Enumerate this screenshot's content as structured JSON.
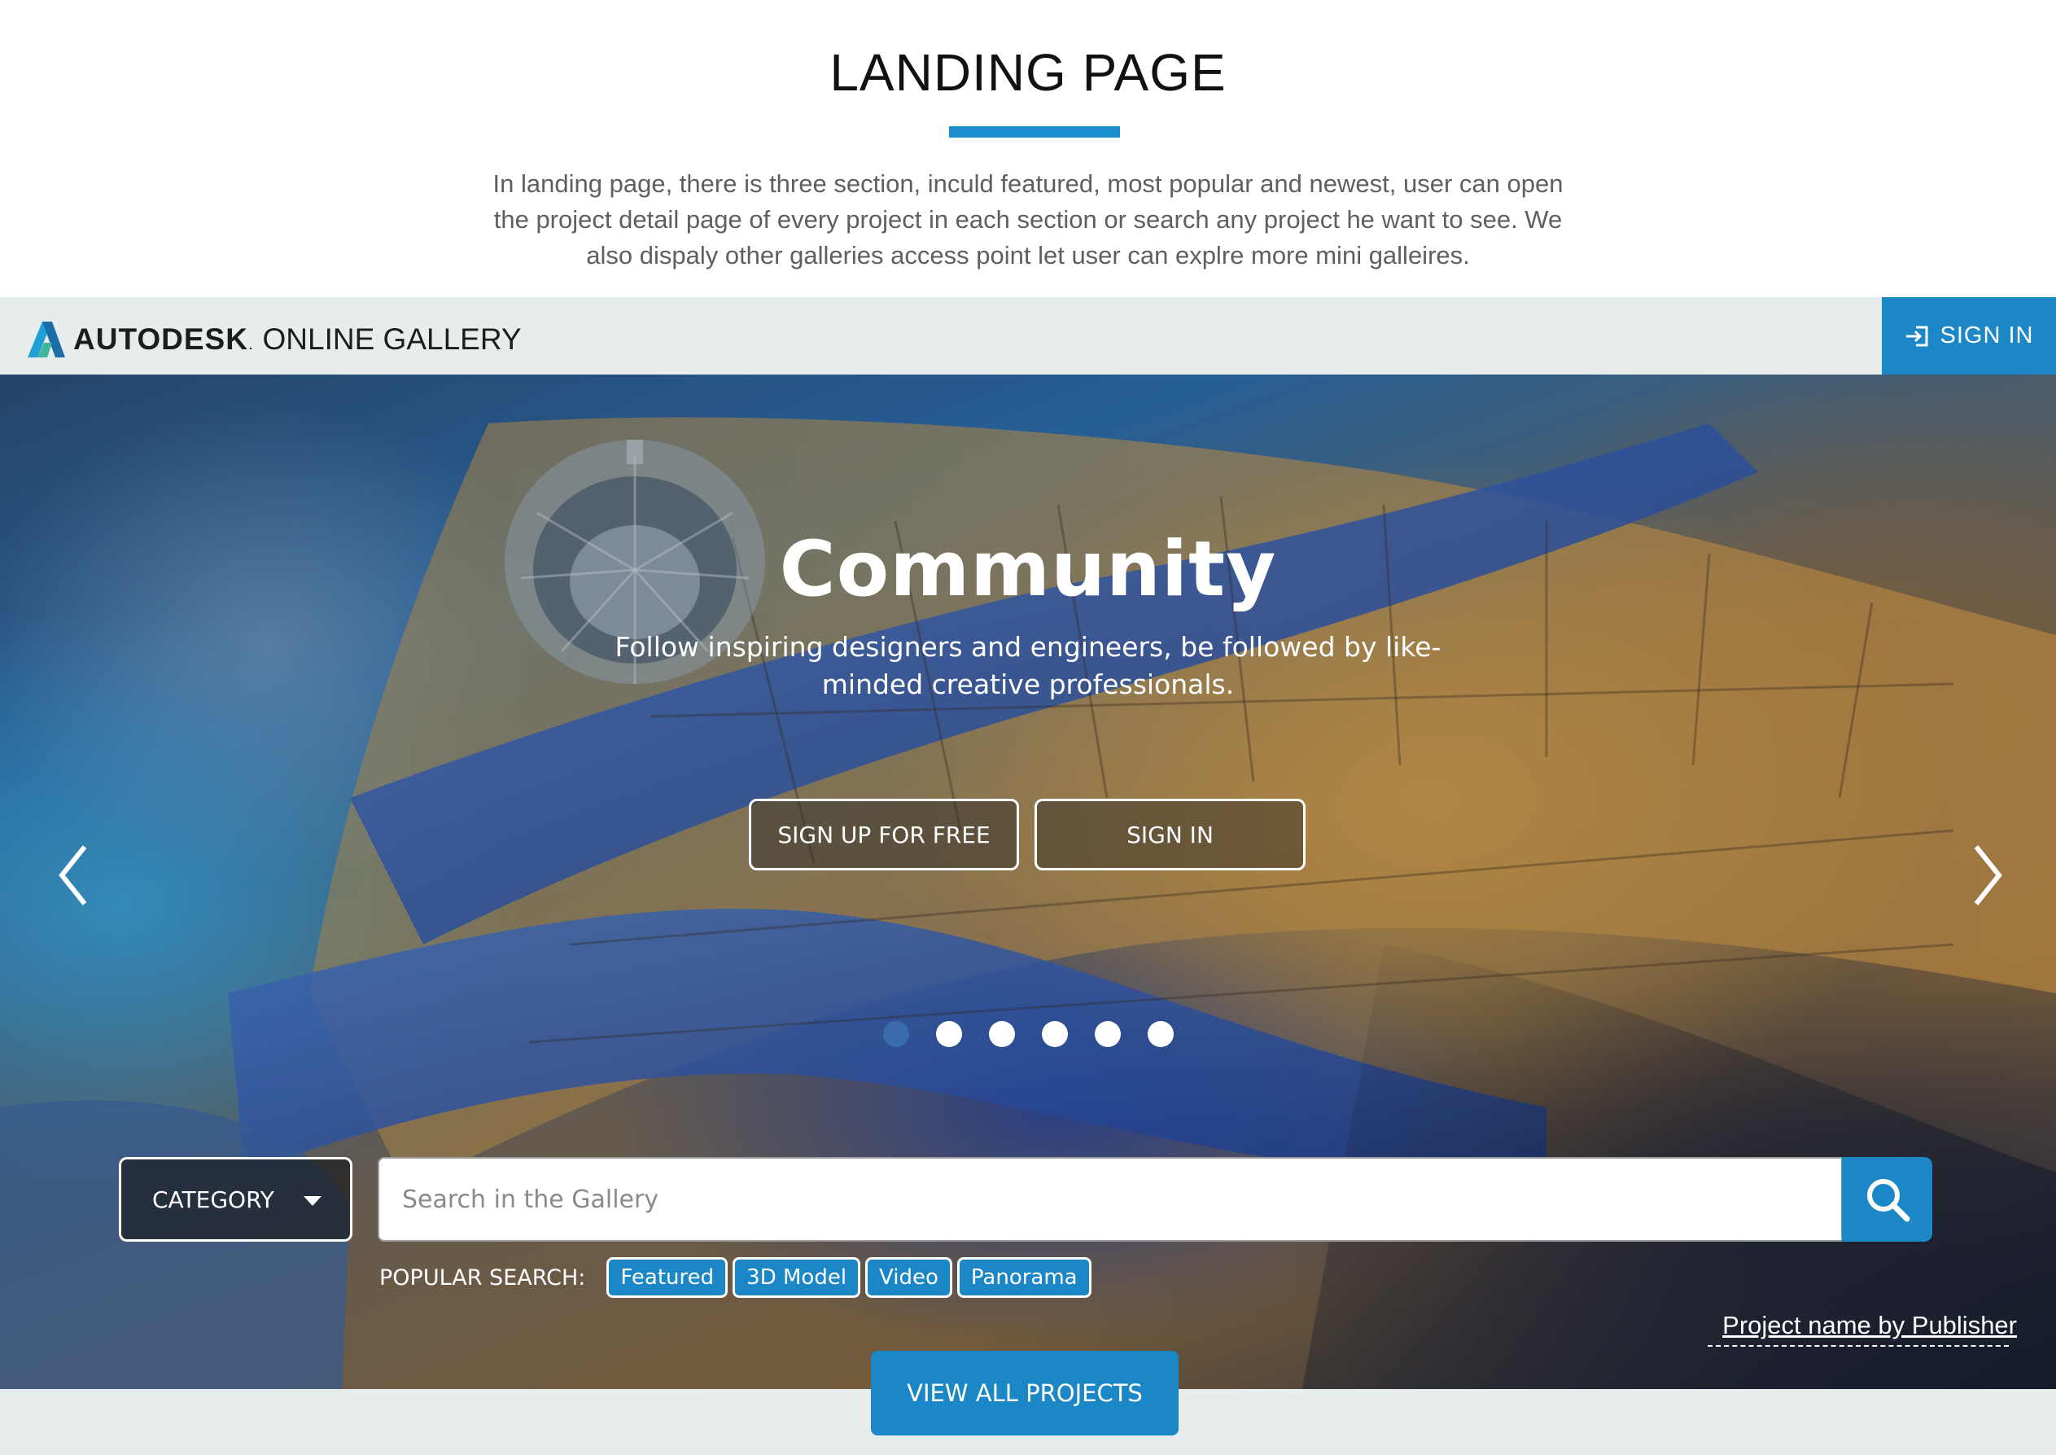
{
  "intro": {
    "title": "LANDING PAGE",
    "description": "In landing page, there is three section, inculd featured, most popular and newest, user can open the project detail page of every project in each section or search any project he want to see. We also dispaly other galleries access point let user can explre more mini galleires."
  },
  "header": {
    "brand_name": "AUTODESK",
    "brand_dot": ".",
    "product_name": "ONLINE GALLERY",
    "signin_label": "SIGN IN"
  },
  "hero": {
    "title": "Community",
    "subtitle": "Follow inspiring designers and engineers, be followed by like-minded creative professionals.",
    "signup_label": "SIGN UP FOR FREE",
    "signin_label": "SIGN IN",
    "slides_total": 6,
    "active_slide": 1,
    "credit": "Project name by Publisher"
  },
  "search": {
    "category_label": "CATEGORY",
    "placeholder": "Search in the Gallery",
    "popular_label": "POPULAR SEARCH:",
    "tags": [
      "Featured",
      "3D Model",
      "Video",
      "Panorama"
    ]
  },
  "footer": {
    "view_all_label": "VIEW ALL PROJECTS"
  },
  "colors": {
    "accent": "#1b87c6",
    "active_dot": "#3a6bab",
    "nav_bg": "#e7eded"
  },
  "icons": [
    "autodesk-logo-icon",
    "sign-in-icon",
    "chevron-left-icon",
    "chevron-right-icon",
    "caret-down-icon",
    "search-icon"
  ]
}
